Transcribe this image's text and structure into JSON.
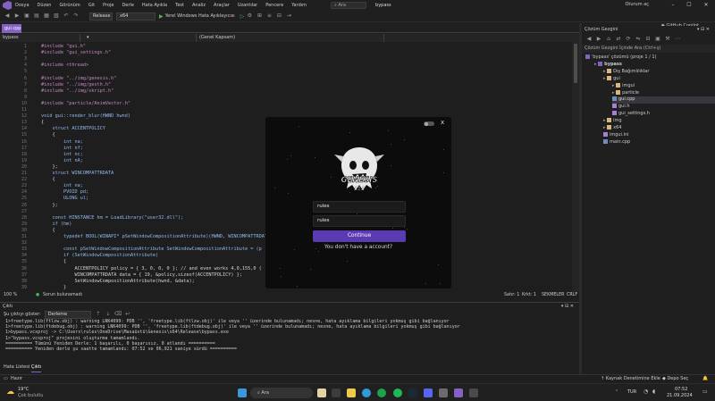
{
  "menu": [
    "Dosya",
    "Düzen",
    "Görünüm",
    "Git",
    "Proje",
    "Derle",
    "Hata Ayıkla",
    "Test",
    "Analiz",
    "Araçlar",
    "Uzantılar",
    "Pencere",
    "Yardım"
  ],
  "search_label": "Ara",
  "solution_title": "bypass",
  "signin": "Oturum aç",
  "copilot": "GitHub Copilot",
  "toolbar": {
    "config": "Release",
    "platform": "x64",
    "run": "Yerel Windows Hata Ayıklayıcısı"
  },
  "editor": {
    "tab": "gui.cpp",
    "nav_project": "bypass",
    "nav_scope": "(Genel Kapsam)",
    "line_numbers": [
      "1",
      "2",
      "3",
      "4",
      "5",
      "6",
      "7",
      "8",
      "9",
      "10",
      "11",
      "12",
      "13",
      "14",
      "15",
      "16",
      "17",
      "18",
      "19",
      "20",
      "21",
      "22",
      "23",
      "24",
      "25",
      "26",
      "27",
      "28",
      "29",
      "30",
      "31",
      "32",
      "33",
      "34",
      "35",
      "36",
      "37",
      "38",
      "39"
    ],
    "lines": [
      "#include \"gui.h\"",
      "#include \"gui_settings.h\"",
      "",
      "#include <thread>",
      "",
      "#include \"../img/genesis.h\"",
      "#include \"../img/gesth.h\"",
      "#include \"../img/skript.h\"",
      "",
      "#include \"particle/AnimVector.h\"",
      "",
      "void gui::render_blur(HWND hwnd)",
      "{",
      "    struct ACCENTPOLICY",
      "    {",
      "        int na;",
      "        int nf;",
      "        int nc;",
      "        int nA;",
      "    };",
      "    struct WINCOMPATTRDATA",
      "    {",
      "        int na;",
      "        PVOID pd;",
      "        ULONG ul;",
      "    };",
      "",
      "    const HINSTANCE hm = LoadLibrary(\"user32.dll\");",
      "    if (hm)",
      "    {",
      "        typedef BOOL(WINAPI* pSetWindowCompositionAttribute)(HWND, WINCOMPATTRDATA*);",
      "",
      "        const pSetWindowCompositionAttribute SetWindowCompositionAttribute = (p                                  nCompositionAttribute\");",
      "        if (SetWindowCompositionAttribute)",
      "        {",
      "            ACCENTPOLICY policy = { 3, 0, 0, 0 }; // and even works 4,0,155,0 (",
      "            WINCOMPATTRDATA data = { 19, &policy,sizeof(ACCENTPOLICY) };",
      "            SetWindowCompositionAttribute(hwnd, &data);",
      "        }"
    ]
  },
  "editor_status": {
    "zoom": "100 %",
    "issues": "Sorun bulunamadı",
    "line": "Satır: 1",
    "char": "Krkt: 1",
    "spaces": "SEKMELER",
    "eol": "CRLF"
  },
  "output": {
    "title": "Çıktı",
    "source_label": "Şu çıktıyı göster:",
    "source_value": "Derleme",
    "lines": [
      "1>freetype.lib(ftlzw.obj) : warning LNK4099: PDB '', 'freetype.lib(ftlzw.obj)' ile veya '' üzerinde bulunamadı; nesne, hata ayıklama bilgileri yokmuş gibi bağlanıyor",
      "1>freetype.lib(ftdebug.obj) : warning LNK4099: PDB '', 'freetype.lib(ftdebug.obj)' ile veya '' üzerinde bulunamadı; nesne, hata ayıklama bilgileri yokmuş gibi bağlanıyor",
      "1>bypass.vcxproj -> C:\\Users\\rules\\OneDrive\\Masaüstü\\Genesis\\x64\\Release\\bypass.exe",
      "1>\"bypass.vcxproj\" projesini oluşturma tamamlandı.",
      "========== Tümünü Yeniden Derle: 1 başarılı, 0 başarısız, 0 atlandı ==========",
      "========== Yeniden derle şu saatte tamamlandı: 07:52 ve 06,921 saniye sürdü =========="
    ]
  },
  "bottom_tabs": [
    "Hata Listesi",
    "Çıktı"
  ],
  "statusbar": {
    "left": "Hazır",
    "right1": "Kaynak Denetimine Ekle",
    "right2": "Depo Seç"
  },
  "solution_explorer": {
    "title": "Çözüm Gezgini",
    "search": "Çözüm Gezgini İçinde Ara (Ctrl+ş)",
    "items": [
      {
        "label": "'bypass' çözümü (proje 1 / 1)",
        "kind": "solution",
        "depth": 0
      },
      {
        "label": "bypass",
        "kind": "project",
        "depth": 1
      },
      {
        "label": "Dış Bağımlılıklar",
        "kind": "folder",
        "depth": 2
      },
      {
        "label": "gui",
        "kind": "folder",
        "depth": 2
      },
      {
        "label": "imgui",
        "kind": "folder",
        "depth": 3
      },
      {
        "label": "particle",
        "kind": "folder",
        "depth": 3
      },
      {
        "label": "gui.cpp",
        "kind": "cpp",
        "depth": 3
      },
      {
        "label": "gui.h",
        "kind": "header",
        "depth": 3
      },
      {
        "label": "gui_settings.h",
        "kind": "header",
        "depth": 3
      },
      {
        "label": "img",
        "kind": "folder",
        "depth": 2
      },
      {
        "label": "x64",
        "kind": "folder",
        "depth": 2
      },
      {
        "label": "imgui.ini",
        "kind": "file",
        "depth": 2
      },
      {
        "label": "main.cpp",
        "kind": "cpp",
        "depth": 2
      }
    ]
  },
  "login": {
    "logo_text": "GENESIS",
    "username_value": "rules",
    "password_value": "rules",
    "continue": "Continue",
    "no_account": "You don't have a account?",
    "close": "x"
  },
  "taskbar": {
    "weather_temp": "19°C",
    "weather_desc": "Çok bulutlu",
    "search": "Ara",
    "lang": "TUR",
    "time": "07:52",
    "date": "21.09.2024"
  },
  "colors": {
    "accent": "#8661c5",
    "button": "#5b3bb2"
  }
}
